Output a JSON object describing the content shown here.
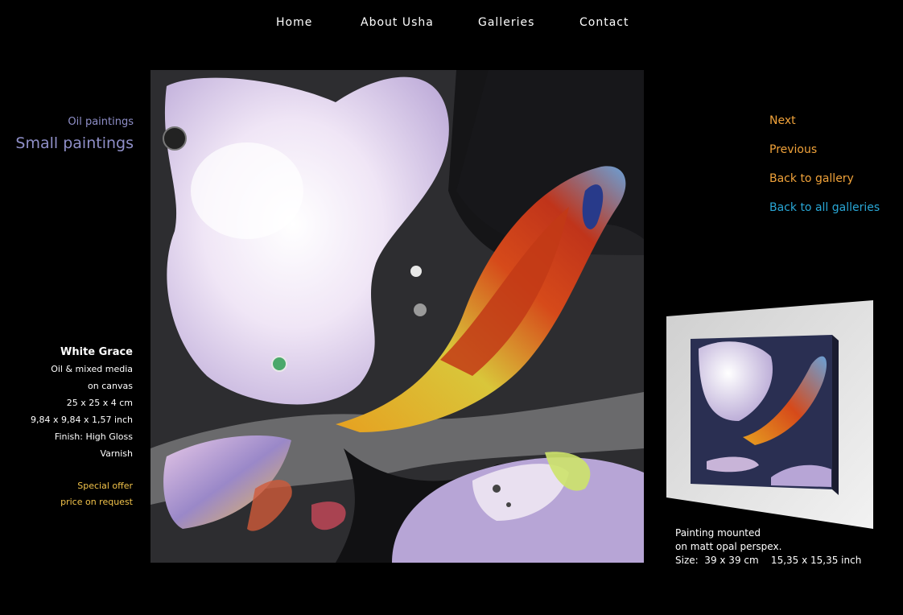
{
  "nav": {
    "home": "Home",
    "about": "About Usha",
    "galleries": "Galleries",
    "contact": "Contact"
  },
  "breadcrumb": {
    "parent": "Oil paintings",
    "current": "Small paintings"
  },
  "artwork": {
    "title": "White Grace",
    "medium_line1": "Oil & mixed media",
    "medium_line2": "on canvas",
    "size_cm": "25 x 25 x 4 cm",
    "size_inch": "9,84 x 9,84 x 1,57 inch",
    "finish_line1": "Finish:  High Gloss",
    "finish_line2": "Varnish",
    "offer_line1": "Special offer",
    "offer_line2": "price on request"
  },
  "sidenav": {
    "next": "Next",
    "previous": "Previous",
    "back_gallery": "Back to gallery",
    "back_all": "Back to all galleries"
  },
  "mounted": {
    "line1": "Painting mounted",
    "line2": "on matt opal perspex.",
    "line3": "Size:  39 x 39 cm    15,35 x 15,35 inch"
  },
  "colors": {
    "background": "#000000",
    "breadcrumb": "#8f8fc8",
    "link_orange": "#f0a23a",
    "link_blue": "#29a7d6",
    "offer": "#f2c34a"
  }
}
